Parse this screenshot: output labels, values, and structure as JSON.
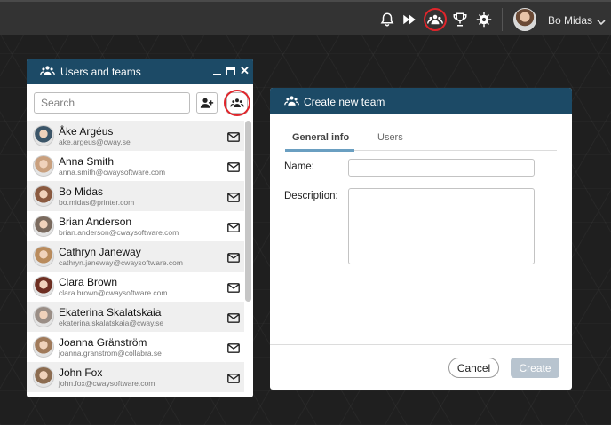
{
  "topbar": {
    "icons": [
      "bell-icon",
      "fast-forward-icon",
      "users-teams-icon",
      "trophy-icon",
      "gear-icon",
      "chevron-down-icon"
    ],
    "user_name": "Bo Midas",
    "highlight_color": "#e0252b"
  },
  "users_panel": {
    "title": "Users and teams",
    "search_placeholder": "Search",
    "header_color": "#1c4a66",
    "users": [
      {
        "name": "Åke Argéus",
        "email": "ake.argeus@cway.se",
        "avatar_color": "#3b5568"
      },
      {
        "name": "Anna Smith",
        "email": "anna.smith@cwaysoftware.com",
        "avatar_color": "#c9a07e"
      },
      {
        "name": "Bo Midas",
        "email": "bo.midas@printer.com",
        "avatar_color": "#8a5a40"
      },
      {
        "name": "Brian Anderson",
        "email": "brian.anderson@cwaysoftware.com",
        "avatar_color": "#7a6a5e"
      },
      {
        "name": "Cathryn Janeway",
        "email": "cathryn.janeway@cwaysoftware.com",
        "avatar_color": "#b98b5c"
      },
      {
        "name": "Clara Brown",
        "email": "clara.brown@cwaysoftware.com",
        "avatar_color": "#6e2f22"
      },
      {
        "name": "Ekaterina Skalatskaia",
        "email": "ekaterina.skalatskaia@cway.se",
        "avatar_color": "#9a8e86"
      },
      {
        "name": "Joanna Gränström",
        "email": "joanna.granstrom@collabra.se",
        "avatar_color": "#a07a5a"
      },
      {
        "name": "John Fox",
        "email": "john.fox@cwaysoftware.com",
        "avatar_color": "#8c6c50"
      }
    ]
  },
  "dialog": {
    "title": "Create new team",
    "tabs": [
      "General info",
      "Users"
    ],
    "name_label": "Name:",
    "name_value": "",
    "description_label": "Description:",
    "description_value": "",
    "cancel_label": "Cancel",
    "create_label": "Create"
  }
}
